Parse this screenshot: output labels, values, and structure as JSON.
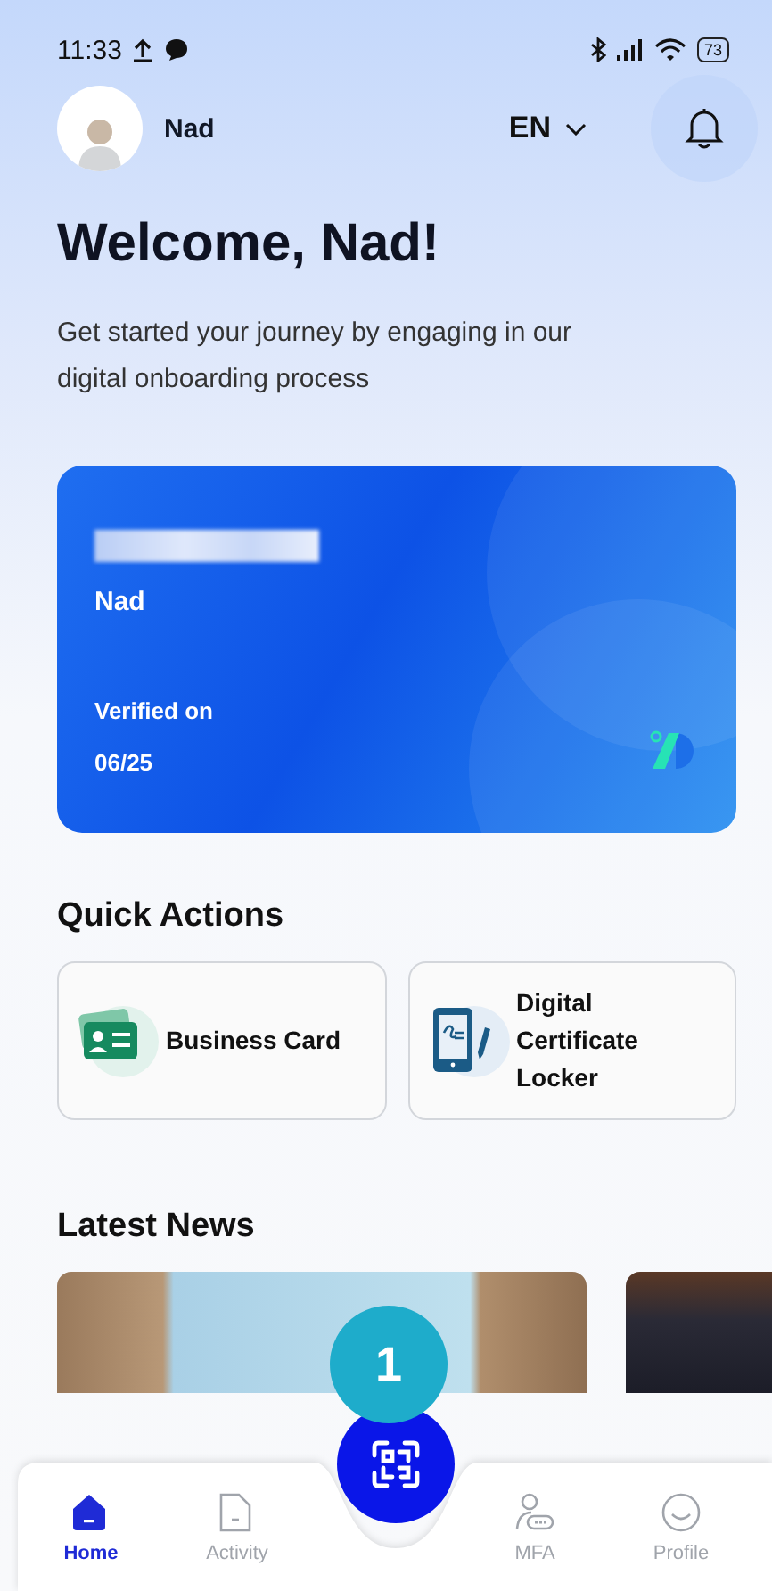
{
  "status_bar": {
    "time": "11:33",
    "battery": "73"
  },
  "header": {
    "user_name": "Nad",
    "language": "EN"
  },
  "welcome": {
    "title": "Welcome, Nad!",
    "subtitle": "Get started your journey by engaging in our digital onboarding process"
  },
  "id_card": {
    "name": "Nad",
    "verified_label": "Verified on",
    "verified_date": "06/25"
  },
  "quick_actions": {
    "title": "Quick Actions",
    "items": [
      {
        "label": "Business Card",
        "kind": "business-card"
      },
      {
        "label": "Digital Certificate Locker",
        "kind": "certificate"
      }
    ]
  },
  "news": {
    "title": "Latest News"
  },
  "tutorial_badge": "1",
  "nav": {
    "items": [
      {
        "label": "Home",
        "kind": "home",
        "selected": true
      },
      {
        "label": "Activity",
        "kind": "activity",
        "selected": false
      },
      {
        "label": "MFA",
        "kind": "mfa",
        "selected": false
      },
      {
        "label": "Profile",
        "kind": "profile",
        "selected": false
      }
    ]
  }
}
